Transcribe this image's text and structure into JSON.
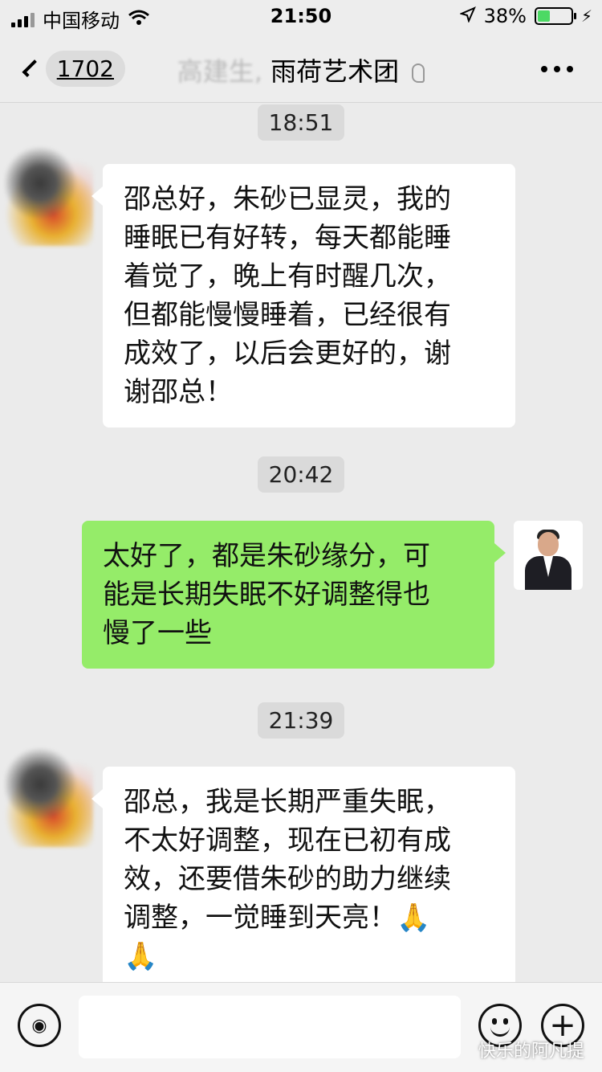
{
  "status_bar": {
    "carrier": "中国移动",
    "time": "21:50",
    "battery": "38%",
    "battery_level": 0.38,
    "icons": [
      "signal-icon",
      "wifi-icon",
      "location-arrow-icon",
      "battery-icon",
      "charging-icon"
    ]
  },
  "nav": {
    "unread_count": "1702",
    "title_blurred": "高建生,",
    "title_main": "雨荷艺术团",
    "icons": [
      "back-chevron-icon",
      "mute-ear-icon",
      "more-icon"
    ]
  },
  "messages": [
    {
      "type": "timestamp",
      "text": "18:51"
    },
    {
      "type": "received",
      "text": "邵总好，朱砂已显灵，我的\n睡眠已有好转，每天都能睡\n着觉了，晚上有时醒几次，\n但都能慢慢睡着，已经很有\n成效了，以后会更好的，谢\n谢邵总！"
    },
    {
      "type": "timestamp",
      "text": "20:42"
    },
    {
      "type": "sent",
      "text": "太好了，都是朱砂缘分，可\n能是长期失眠不好调整得也\n慢了一些"
    },
    {
      "type": "timestamp",
      "text": "21:39"
    },
    {
      "type": "received",
      "text": "邵总，我是长期严重失眠，\n不太好调整，现在已初有成\n效，还要借朱砂的助力继续\n调整，一觉睡到天亮！🙏\n🙏"
    }
  ],
  "input_bar": {
    "placeholder": "",
    "icons": [
      "voice-icon",
      "emoji-icon",
      "plus-icon"
    ],
    "plus_glyph": "+",
    "voice_glyph": "◉"
  },
  "watermark": "快乐的阿凡提",
  "colors": {
    "chat_background": "#ebebeb",
    "sent_bubble": "#95ec69",
    "received_bubble": "#ffffff",
    "battery_fill": "#4cd964"
  }
}
